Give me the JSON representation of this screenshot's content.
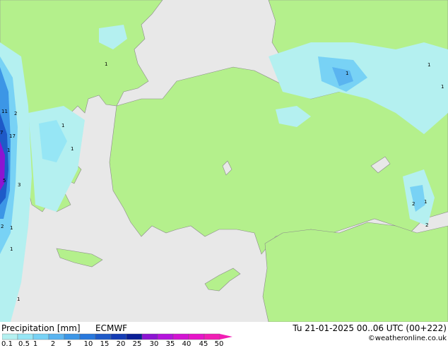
{
  "map": {
    "labels": [
      "1",
      "1",
      "1",
      "1",
      "1",
      "1",
      "1",
      "1",
      "1",
      "11",
      "2",
      "7",
      "17",
      "1",
      "5",
      "3",
      "2",
      "2",
      "1",
      "2"
    ]
  },
  "footer": {
    "title": "Precipitation [mm]",
    "model": "ECMWF",
    "datetime": "Tu 21-01-2025 00..06 UTC (00+222)",
    "credit": "©weatheronline.co.uk"
  },
  "colorbar": {
    "ticks": [
      "0.1",
      "0.5",
      "1",
      "2",
      "5",
      "10",
      "15",
      "20",
      "25",
      "30",
      "35",
      "40",
      "45",
      "50"
    ],
    "colors": [
      "#b4f0f0",
      "#96e6f5",
      "#78d2f5",
      "#5ab4f0",
      "#3c96e6",
      "#2878dc",
      "#1e5ac8",
      "#143cb4",
      "#0a1e96",
      "#8c14d2",
      "#b414dc",
      "#d214d2",
      "#e614c8",
      "#f01eb4"
    ]
  }
}
